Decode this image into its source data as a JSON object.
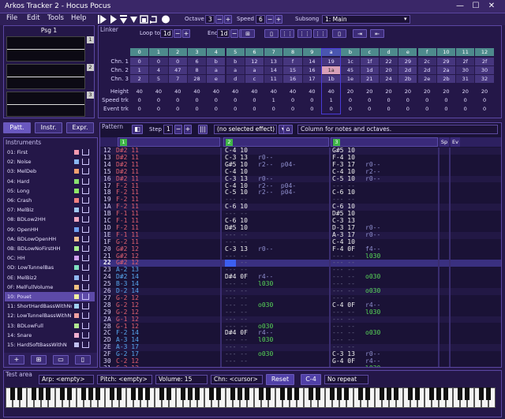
{
  "app": {
    "title": "Arkos Tracker 2 - Hocus Pocus",
    "minimize_glyph": "—",
    "maximize_glyph": "☐",
    "close_glyph": "✕"
  },
  "menu": [
    "File",
    "Edit",
    "Tools",
    "Help"
  ],
  "toolbar": {
    "octave_label": "Octave",
    "octave_value": "3",
    "speed_label": "Speed",
    "speed_value": "6",
    "subsong_label": "Subsong",
    "subsong_value": "1: Main",
    "minus": "−",
    "plus": "+"
  },
  "psg": {
    "title": "Psg 1",
    "channels": [
      "1",
      "2",
      "3"
    ]
  },
  "linker": {
    "title": "Linker",
    "loop_to_label": "Loop to",
    "loop_to_value": "1d",
    "end_label": "End",
    "end_value": "1d",
    "columns": [
      "0",
      "1",
      "2",
      "3",
      "4",
      "5",
      "6",
      "7",
      "8",
      "9",
      "a",
      "b",
      "c",
      "d",
      "e",
      "f",
      "10",
      "11",
      "12"
    ],
    "rows": [
      {
        "label": "Chn. 1",
        "values": [
          "0",
          "0",
          "0",
          "6",
          "b",
          "b",
          "12",
          "13",
          "f",
          "14",
          "19",
          "1c",
          "1f",
          "22",
          "29",
          "2c",
          "29",
          "2f",
          "2f"
        ]
      },
      {
        "label": "Chn. 2",
        "values": [
          "1",
          "4",
          "47",
          "8",
          "a",
          "a",
          "a",
          "14",
          "15",
          "16",
          "1a",
          "45",
          "1d",
          "20",
          "2d",
          "2d",
          "2a",
          "30",
          "30"
        ]
      },
      {
        "label": "Chn. 3",
        "values": [
          "2",
          "5",
          "7",
          "28",
          "e",
          "d",
          "c",
          "11",
          "16",
          "17",
          "1b",
          "1e",
          "21",
          "24",
          "2b",
          "2e",
          "2b",
          "31",
          "32"
        ]
      },
      {
        "label": "Height",
        "values": [
          "40",
          "40",
          "40",
          "40",
          "40",
          "40",
          "40",
          "40",
          "40",
          "40",
          "40",
          "20",
          "20",
          "20",
          "20",
          "20",
          "20",
          "20",
          "20"
        ]
      },
      {
        "label": "Speed trk",
        "values": [
          "0",
          "0",
          "0",
          "0",
          "0",
          "0",
          "0",
          "1",
          "0",
          "0",
          "1",
          "0",
          "0",
          "0",
          "0",
          "0",
          "0",
          "0",
          "0"
        ]
      },
      {
        "label": "Event trk",
        "values": [
          "0",
          "0",
          "0",
          "0",
          "0",
          "0",
          "0",
          "0",
          "0",
          "0",
          "0",
          "0",
          "0",
          "0",
          "0",
          "0",
          "0",
          "0",
          "0"
        ]
      }
    ]
  },
  "tabs": {
    "pattern": "Patt.",
    "instruments": "Instr.",
    "expressions": "Expr."
  },
  "instruments": {
    "title": "Instruments",
    "items": [
      {
        "name": "01: First",
        "color": "#f59ab0"
      },
      {
        "name": "02: Noise",
        "color": "#8ab6f0"
      },
      {
        "name": "03: MelDeb",
        "color": "#f2a070"
      },
      {
        "name": "04: Hard",
        "color": "#88e070"
      },
      {
        "name": "05: Long",
        "color": "#8ee868"
      },
      {
        "name": "06: Crash",
        "color": "#f08080"
      },
      {
        "name": "07: MelBiz",
        "color": "#a0c8f0"
      },
      {
        "name": "08: BDLow2HH",
        "color": "#f0a8c0"
      },
      {
        "name": "09: OpenHH",
        "color": "#70a0f0"
      },
      {
        "name": "0A: BDLowOpenHH",
        "color": "#f4c090"
      },
      {
        "name": "0B: BDLowNoFirstHH",
        "color": "#a8f090"
      },
      {
        "name": "0C: HH",
        "color": "#d0a0f0"
      },
      {
        "name": "0D: LowTunnelBas",
        "color": "#80e0c0"
      },
      {
        "name": "0E: MelBiz2",
        "color": "#90b8f0"
      },
      {
        "name": "0F: MelFullVolume",
        "color": "#f0c080"
      },
      {
        "name": "10: Pouet",
        "color": "#f0f0a0"
      },
      {
        "name": "11: ShortHardBassWithNo",
        "color": "#a0d0f0"
      },
      {
        "name": "12: LowTunnelBassWithN",
        "color": "#f0a0a0"
      },
      {
        "name": "13: BDLowFull",
        "color": "#b0e890"
      },
      {
        "name": "14: Snare",
        "color": "#f0b0d0"
      },
      {
        "name": "15: HardSoftBassWithN",
        "color": "#c0c0f0"
      }
    ]
  },
  "pattern": {
    "title": "Pattern",
    "step_label": "Step",
    "step_value": "1",
    "effect_value": "(no selected effect)",
    "hint": "Column for notes and octaves.",
    "tracks": [
      "1",
      "2",
      "3"
    ],
    "speed_header": "Sp",
    "event_header": "Ev",
    "rows": [
      {
        "n": "12",
        "t1": "D#2 11",
        "t2": "C-4 10",
        "t2e": "",
        "t3": "G#5 10",
        "t3e": ""
      },
      {
        "n": "13",
        "t1": "D#2 11",
        "t2": "C-3 13",
        "t2e": "r0--",
        "t3": "F-4 10",
        "t3e": ""
      },
      {
        "n": "14",
        "t1": "D#2 11",
        "t2": "G#5 10",
        "t2e": "r2--  p04-",
        "t3": "F-3 17",
        "t3e": "r0--"
      },
      {
        "n": "15",
        "t1": "D#2 11",
        "t2": "C-4 10",
        "t2e": "",
        "t3": "C-4 10",
        "t3e": "r2--"
      },
      {
        "n": "16",
        "t1": "D#2 11",
        "t2": "C-3 13",
        "t2e": "r0--",
        "t3": "C-5 10",
        "t3e": "r0--"
      },
      {
        "n": "17",
        "t1": "F-2 11",
        "t2": "C-4 10",
        "t2e": "r2--  p04-",
        "t3": "--- --",
        "t3e": ""
      },
      {
        "n": "18",
        "t1": "F-2 11",
        "t2": "C-5 10",
        "t2e": "r2--  p04-",
        "t3": "C-6 10",
        "t3e": ""
      },
      {
        "n": "19",
        "t1": "F-2 11",
        "t2": "--- --",
        "t2e": "",
        "t3": "--- --",
        "t3e": ""
      },
      {
        "n": "1A",
        "t1": "F-2 11",
        "t2": "C-6 10",
        "t2e": "",
        "t3": "C-6 10",
        "t3e": ""
      },
      {
        "n": "1B",
        "t1": "F-1 11",
        "t2": "--- --",
        "t2e": "",
        "t3": "D#5 10",
        "t3e": ""
      },
      {
        "n": "1C",
        "t1": "F-1 11",
        "t2": "C-6 10",
        "t2e": "",
        "t3": "C-3 13",
        "t3e": ""
      },
      {
        "n": "1D",
        "t1": "F-2 11",
        "t2": "D#5 10",
        "t2e": "",
        "t3": "D-3 17",
        "t3e": "r0--"
      },
      {
        "n": "1E",
        "t1": "F-1 11",
        "t2": "--- --",
        "t2e": "",
        "t3": "A-3 17",
        "t3e": "r0--"
      },
      {
        "n": "1F",
        "t1": "G-2 11",
        "t2": "--- --",
        "t2e": "",
        "t3": "C-4 10",
        "t3e": ""
      },
      {
        "n": "20",
        "t1": "G#2 12",
        "t2": "C-3 13",
        "t2e": "r0--",
        "t3": "F-4 0F",
        "t3e": "f4--"
      },
      {
        "n": "21",
        "t1": "G#2 12",
        "t2": "--- --",
        "t2e": "",
        "t3": "--- --",
        "t3e": "l030"
      },
      {
        "n": "22",
        "t1": "G#2 12",
        "t2": "--- --",
        "t2e": "",
        "t3": "--- --",
        "t3e": ""
      },
      {
        "n": "23",
        "t1": "A-2 13",
        "t2": "--- --",
        "t2e": "",
        "t3": "--- --",
        "t3e": ""
      },
      {
        "n": "24",
        "t1": "D#2 14",
        "t2": "D#4 0F",
        "t2e": "r4--",
        "t3": "--- --",
        "t3e": "o030"
      },
      {
        "n": "25",
        "t1": "B-3 14",
        "t2": "--- --",
        "t2e": "l030",
        "t3": "--- --",
        "t3e": ""
      },
      {
        "n": "26",
        "t1": "D-2 14",
        "t2": "--- --",
        "t2e": "",
        "t3": "--- --",
        "t3e": "o030"
      },
      {
        "n": "27",
        "t1": "G-2 12",
        "t2": "--- --",
        "t2e": "",
        "t3": "--- --",
        "t3e": ""
      },
      {
        "n": "28",
        "t1": "G-2 12",
        "t2": "--- --",
        "t2e": "o030",
        "t3": "C-4 0F",
        "t3e": "r4--"
      },
      {
        "n": "29",
        "t1": "G-2 12",
        "t2": "--- --",
        "t2e": "",
        "t3": "--- --",
        "t3e": "l030"
      },
      {
        "n": "2A",
        "t1": "G-1 12",
        "t2": "--- --",
        "t2e": "",
        "t3": "--- --",
        "t3e": ""
      },
      {
        "n": "2B",
        "t1": "G-1 12",
        "t2": "--- --",
        "t2e": "o030",
        "t3": "--- --",
        "t3e": ""
      },
      {
        "n": "2C",
        "t1": "F-2 14",
        "t2": "D#4 0F",
        "t2e": "r4--",
        "t3": "--- --",
        "t3e": "o030"
      },
      {
        "n": "2D",
        "t1": "A-3 14",
        "t2": "--- --",
        "t2e": "l030",
        "t3": "--- --",
        "t3e": ""
      },
      {
        "n": "2E",
        "t1": "A-3 17",
        "t2": "--- --",
        "t2e": "",
        "t3": "--- --",
        "t3e": ""
      },
      {
        "n": "2F",
        "t1": "G-2 17",
        "t2": "--- --",
        "t2e": "o030",
        "t3": "C-3 13",
        "t3e": "r0--"
      },
      {
        "n": "30",
        "t1": "C-2 12",
        "t2": "--- --",
        "t2e": "",
        "t3": "G-4 0F",
        "t3e": "r4--"
      },
      {
        "n": "31",
        "t1": "C-2 12",
        "t2": "--- --",
        "t2e": "",
        "t3": "--- --",
        "t3e": "l030"
      },
      {
        "n": "32",
        "t1": "C-1 12",
        "t2": "--- --",
        "t2e": "",
        "t3": "--- --",
        "t3e": ""
      },
      {
        "n": "33",
        "t1": "C-2 12",
        "t2": "--- --",
        "t2e": "",
        "t3": "--- --",
        "t3e": ""
      }
    ]
  },
  "test_area": {
    "title": "Test area",
    "arp": "Arp: <empty>",
    "pitch": "Pitch: <empty>",
    "volume": "Volume: 15",
    "channel": "Chn: <cursor>",
    "reset": "Reset",
    "note": "C-4",
    "repeat": "No repeat"
  },
  "colors": {
    "selected_column": "#4a3ad8",
    "cursor_row": "#3a3080",
    "accent": "#7d64d8"
  }
}
